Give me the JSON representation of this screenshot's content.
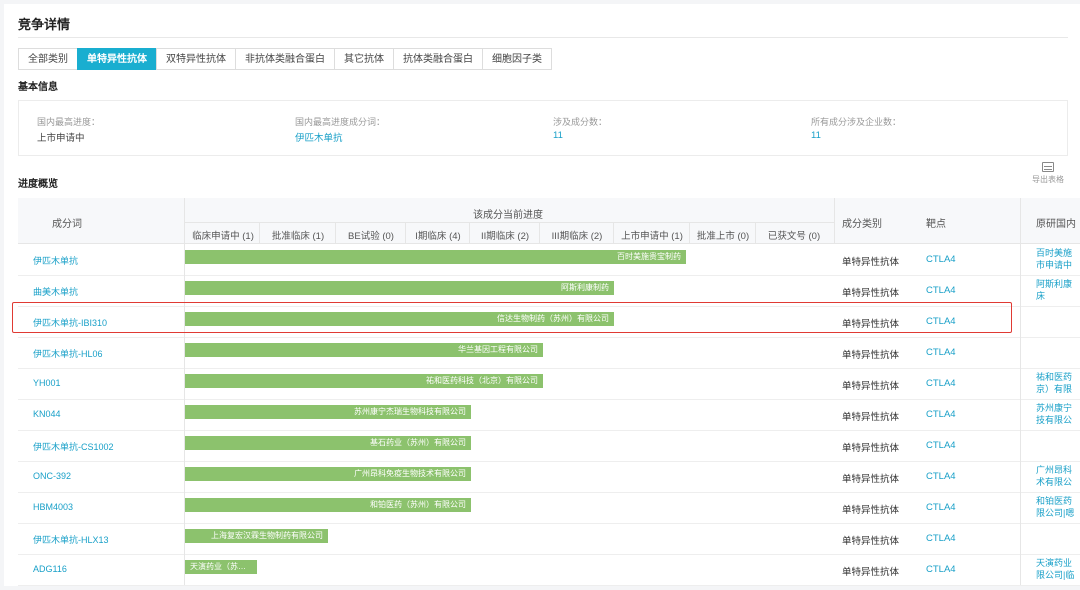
{
  "page": {
    "title": "竞争详情"
  },
  "tabs": [
    {
      "label": "全部类别",
      "active": false
    },
    {
      "label": "单特异性抗体",
      "active": true
    },
    {
      "label": "双特异性抗体",
      "active": false
    },
    {
      "label": "非抗体类融合蛋白",
      "active": false
    },
    {
      "label": "其它抗体",
      "active": false
    },
    {
      "label": "抗体类融合蛋白",
      "active": false
    },
    {
      "label": "细胞因子类",
      "active": false
    }
  ],
  "basic": {
    "title": "基本信息",
    "fields": [
      {
        "label": "国内最高进度：",
        "value": "上市申请中"
      },
      {
        "label": "国内最高进度成分词：",
        "value": "伊匹木单抗"
      },
      {
        "label": "涉及成分数：",
        "value": "11"
      },
      {
        "label": "所有成分涉及企业数：",
        "value": "11"
      }
    ]
  },
  "progress": {
    "title": "进度概览",
    "export_label": "导出表格"
  },
  "table": {
    "col_name": "成分词",
    "col_stage_group": "该成分当前进度",
    "stages": [
      "临床申请中 (1)",
      "批准临床 (1)",
      "BE试验 (0)",
      "I期临床 (4)",
      "II期临床 (2)",
      "III期临床 (2)",
      "上市申请中 (1)",
      "批准上市 (0)",
      "已获文号 (0)"
    ],
    "col_category": "成分类别",
    "col_target": "靶点",
    "col_origin": "原研国内",
    "rows": [
      {
        "name": "伊匹木单抗",
        "company": "百时美施贵宝制药",
        "stage_fraction": 0.77,
        "category": "单特异性抗体",
        "target": "CTLA4",
        "origin": [
          "百时美施",
          "市申请中"
        ]
      },
      {
        "name": "曲美木单抗",
        "company": "阿斯利康制药",
        "stage_fraction": 0.66,
        "category": "单特异性抗体",
        "target": "CTLA4",
        "origin": [
          "阿斯利康",
          "床"
        ]
      },
      {
        "name": "伊匹木单抗-IBI310",
        "company": "信达生物制药（苏州）有限公司",
        "stage_fraction": 0.66,
        "category": "单特异性抗体",
        "target": "CTLA4",
        "origin": []
      },
      {
        "name": "伊匹木单抗-HL06",
        "company": "华兰基因工程有限公司",
        "stage_fraction": 0.55,
        "category": "单特异性抗体",
        "target": "CTLA4",
        "origin": []
      },
      {
        "name": "YH001",
        "company": "祐和医药科技（北京）有限公司",
        "stage_fraction": 0.55,
        "category": "单特异性抗体",
        "target": "CTLA4",
        "origin": [
          "祐和医药",
          "京）有限"
        ]
      },
      {
        "name": "KN044",
        "company": "苏州康宁杰瑞生物科技有限公司",
        "stage_fraction": 0.44,
        "category": "单特异性抗体",
        "target": "CTLA4",
        "origin": [
          "苏州康宁",
          "技有限公"
        ]
      },
      {
        "name": "伊匹木单抗-CS1002",
        "company": "基石药业（苏州）有限公司",
        "stage_fraction": 0.44,
        "category": "单特异性抗体",
        "target": "CTLA4",
        "origin": []
      },
      {
        "name": "ONC-392",
        "company": "广州昂科免疫生物技术有限公司",
        "stage_fraction": 0.44,
        "category": "单特异性抗体",
        "target": "CTLA4",
        "origin": [
          "广州昂科",
          "术有限公"
        ]
      },
      {
        "name": "HBM4003",
        "company": "和铂医药（苏州）有限公司",
        "stage_fraction": 0.44,
        "category": "单特异性抗体",
        "target": "CTLA4",
        "origin": [
          "和铂医药",
          "限公司|嗯"
        ]
      },
      {
        "name": "伊匹木单抗-HLX13",
        "company": "上海复宏汉霖生物制药有限公司",
        "stage_fraction": 0.22,
        "category": "单特异性抗体",
        "target": "CTLA4",
        "origin": []
      },
      {
        "name": "ADG116",
        "company": "天演药业（苏…",
        "stage_fraction": 0.11,
        "category": "单特异性抗体",
        "target": "CTLA4",
        "origin": [
          "天演药业",
          "限公司|临"
        ]
      }
    ]
  }
}
